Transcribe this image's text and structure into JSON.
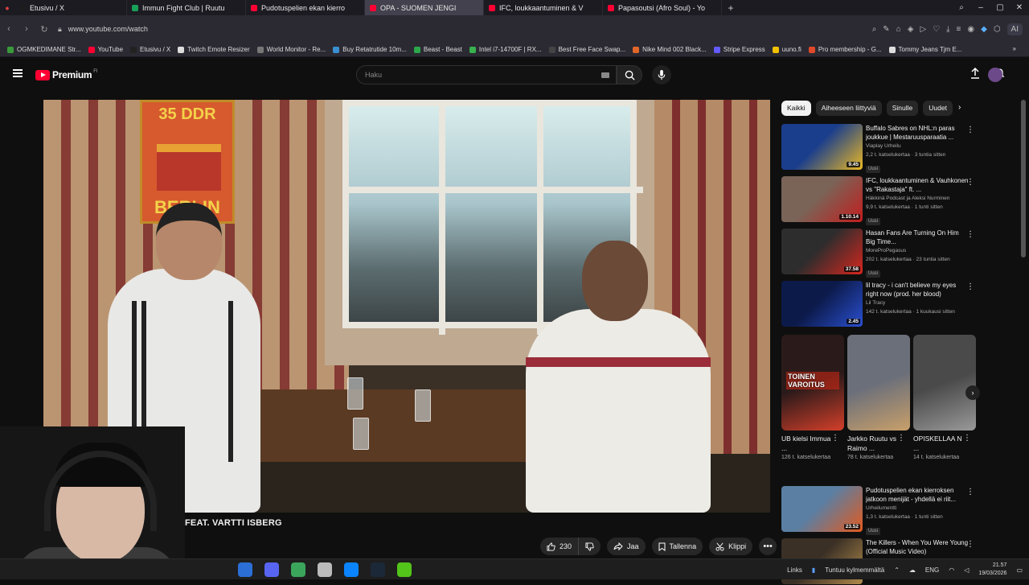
{
  "browser": {
    "tabs": [
      {
        "title": "Etusivu / X",
        "color": "#1d1d1d"
      },
      {
        "title": "Immun Fight Club | Ruutu",
        "color": "#18a058"
      },
      {
        "title": "Pudotuspelien ekan kierro",
        "color": "#ff0033"
      },
      {
        "title": "OPA - SUOMEN JENGI",
        "color": "#ff0033"
      },
      {
        "title": "IFC, loukkaantuminen & V",
        "color": "#ff0033"
      },
      {
        "title": "Papasoutsi (Afro Soul) - Yo",
        "color": "#ff0033"
      }
    ],
    "active_tab_index": 3,
    "url": "www.youtube.com/watch",
    "ai_label": "AI",
    "bookmarks": [
      {
        "label": "OGMKEDIMANE Str...",
        "color": "#3a9a3a"
      },
      {
        "label": "YouTube",
        "color": "#ff0033"
      },
      {
        "label": "Etusivu / X",
        "color": "#222222"
      },
      {
        "label": "Twitch Emote Resizer",
        "color": "#dddddd"
      },
      {
        "label": "World Monitor - Re...",
        "color": "#777777"
      },
      {
        "label": "Buy Retatrutide 10m...",
        "color": "#3a8fd0"
      },
      {
        "label": "Beast - Beast",
        "color": "#2aa84a"
      },
      {
        "label": "Intel i7-14700F | RX...",
        "color": "#37b24d"
      },
      {
        "label": "Best Free Face Swap...",
        "color": "#444444"
      },
      {
        "label": "Nike Mind 002 Black...",
        "color": "#e0662a"
      },
      {
        "label": "Stripe Express",
        "color": "#635bff"
      },
      {
        "label": "uuno.fi",
        "color": "#f2c200"
      },
      {
        "label": "Pro membership - G...",
        "color": "#e04a2a"
      },
      {
        "label": "Tommy Jeans Tjm E...",
        "color": "#dddddd"
      }
    ]
  },
  "youtube": {
    "logo_text": "Premium",
    "country": "FI",
    "search_placeholder": "Haku",
    "video": {
      "title": "FEAT. VARTTI ISBERG",
      "poster_top": "35 DDR",
      "poster_bottom": "BERLIN",
      "likes": "230",
      "share_label": "Jaa",
      "save_label": "Tallenna",
      "clip_label": "Klippi"
    },
    "chips": [
      "Kaikki",
      "Aiheeseen liittyviä",
      "Sinulle",
      "Uudet"
    ],
    "recommendations": [
      {
        "title": "Buffalo Sabres on NHL:n paras joukkue | Mestaruusparaatia ...",
        "channel": "Viaplay Urheilu",
        "meta": "2,2 t. katselukertaa · 3 tuntia sitten",
        "badge": "Uusi",
        "duration": "9.45",
        "colors": [
          "#1a3e8c",
          "#e9b824"
        ]
      },
      {
        "title": "IFC, loukkaantuminen & Vauhkonen vs \"Rakastaja\" ft. ...",
        "channel": "Häkkinä Podcast ja Aleksi Nurminen",
        "meta": "9,9 t. katselukertaa · 1 tunti sitten",
        "badge": "Uusi",
        "duration": "1.10.14",
        "colors": [
          "#7a6458",
          "#c21d1d"
        ]
      },
      {
        "title": "Hasan Fans Are Turning On Him Big Time...",
        "channel": "MoreProPegasus",
        "meta": "202 t. katselukertaa · 23 tuntia sitten",
        "badge": "Uusi",
        "duration": "37.58",
        "colors": [
          "#2d2d2d",
          "#d7261e"
        ]
      },
      {
        "title": "lil tracy - i can't believe my eyes right now (prod. her blood)",
        "channel": "Lil Tracy",
        "meta": "142 t. katselukertaa · 1 kuukausi sitten",
        "badge": "",
        "duration": "2.45",
        "colors": [
          "#0c1a4a",
          "#2a4fd0"
        ]
      },
      {
        "title": "Pudotuspelien ekan kierroksen jatkoon menijät - yhdellä ei riit...",
        "channel": "Urheilumentti",
        "meta": "1,3 t. katselukertaa · 1 tunti sitten",
        "badge": "Uusi",
        "duration": "23.52",
        "colors": [
          "#5a7fa3",
          "#e35a1e"
        ]
      },
      {
        "title": "The Killers - When You Were Young (Official Music Video)",
        "channel": "",
        "meta": "",
        "badge": "",
        "duration": "",
        "colors": [
          "#3b3026",
          "#b08a4a"
        ]
      }
    ],
    "shorts": [
      {
        "title": "UB kielsi Immua ...",
        "meta": "126 t. katselukertaa",
        "overlay": "TOINEN VAROITUS",
        "colors": [
          "#2a1a1a",
          "#d43f2a"
        ]
      },
      {
        "title": "Jarkko Ruutu vs Raimo ...",
        "meta": "78 t. katselukertaa",
        "overlay": "",
        "colors": [
          "#6b6f7a",
          "#c9a06a"
        ]
      },
      {
        "title": "OPISKELLAA N ...",
        "meta": "14 t. katselukertaa",
        "overlay": "",
        "colors": [
          "#4a4a4a",
          "#999999"
        ]
      }
    ]
  },
  "taskbar": {
    "links_label": "Links",
    "weather": "Tuntuu kylmemmältä",
    "lang": "ENG",
    "time": "21.57",
    "date": "19/03/2026",
    "apps": [
      "#2b6fd6",
      "#5865f2",
      "#3ba55c",
      "#bbbbbb",
      "#0a84ff",
      "#1b2838",
      "#52c41a"
    ]
  }
}
